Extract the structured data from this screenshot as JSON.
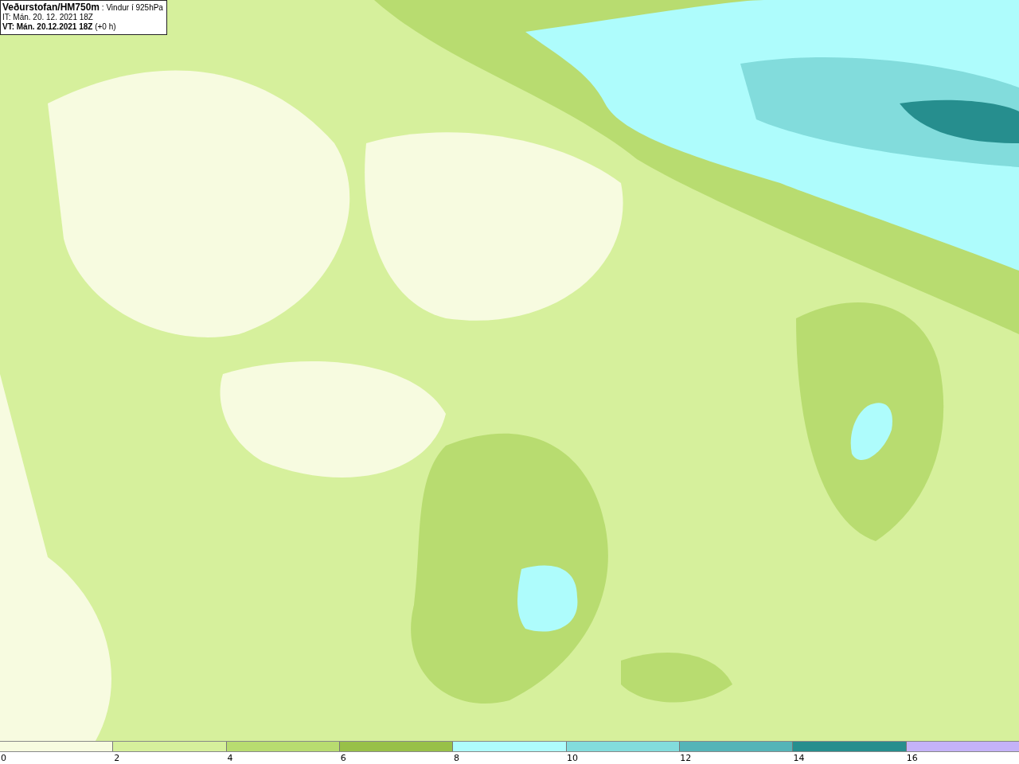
{
  "info_box": {
    "lines": [
      "**Veðurstofan/HM750m** : Vindur í 925hPa",
      "IT: Mán. 20. 12. 2021 18Z",
      "**VT: Mán. 20.12.2021 18Z** (+0 h)"
    ]
  },
  "legend": [
    {
      "label": "0",
      "color": "#f7fbe0"
    },
    {
      "label": "2",
      "color": "#d6f09c"
    },
    {
      "label": "4",
      "color": "#b8dc70"
    },
    {
      "label": "6",
      "color": "#98c048"
    },
    {
      "label": "8",
      "color": "#aefcfc"
    },
    {
      "label": "10",
      "color": "#82dcdc"
    },
    {
      "label": "12",
      "color": "#54b4b8"
    },
    {
      "label": "14",
      "color": "#268e8e"
    },
    {
      "label": "16",
      "color": "#c4b2f8"
    }
  ]
}
